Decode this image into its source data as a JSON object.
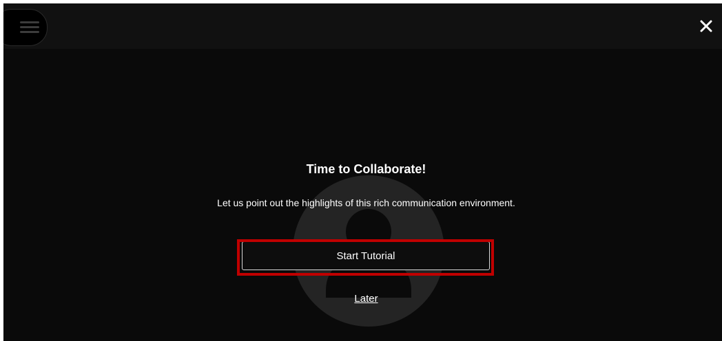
{
  "header": {
    "menu_icon": "hamburger-menu-icon",
    "close_icon": "close-icon"
  },
  "background": {
    "avatar_icon": "user-avatar-icon"
  },
  "dialog": {
    "title": "Time to Collaborate!",
    "subtitle": "Let us point out the highlights of this rich communication environment.",
    "start_label": "Start Tutorial",
    "later_label": "Later"
  },
  "annotation": {
    "highlight_color": "#c00000"
  },
  "colors": {
    "background": "#0a0a0a",
    "text": "#ffffff"
  }
}
